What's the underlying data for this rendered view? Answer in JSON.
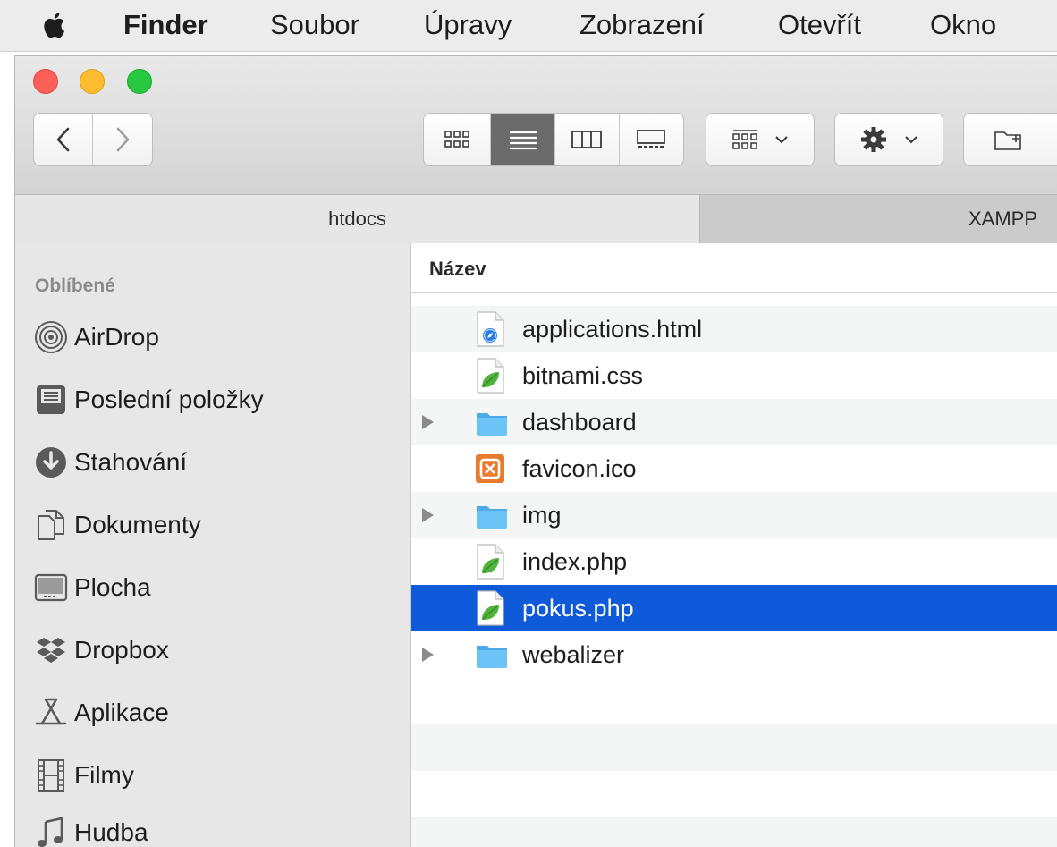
{
  "menubar": {
    "app_name": "Finder",
    "items": [
      "Soubor",
      "Úpravy",
      "Zobrazení",
      "Otevřít",
      "Okno"
    ]
  },
  "tabs": {
    "active": "htdocs",
    "other": "XAMPP"
  },
  "sidebar": {
    "heading": "Oblíbené",
    "items": [
      {
        "label": "AirDrop",
        "icon": "airdrop-icon"
      },
      {
        "label": "Poslední položky",
        "icon": "recents-icon"
      },
      {
        "label": "Stahování",
        "icon": "downloads-icon"
      },
      {
        "label": "Dokumenty",
        "icon": "documents-icon"
      },
      {
        "label": "Plocha",
        "icon": "desktop-icon"
      },
      {
        "label": "Dropbox",
        "icon": "dropbox-icon"
      },
      {
        "label": "Aplikace",
        "icon": "applications-icon"
      },
      {
        "label": "Filmy",
        "icon": "movies-icon"
      },
      {
        "label": "Hudba",
        "icon": "music-icon"
      }
    ]
  },
  "list": {
    "column_name": "Název",
    "files": [
      {
        "name": "applications.html",
        "type": "html",
        "expandable": false,
        "selected": false
      },
      {
        "name": "bitnami.css",
        "type": "leaf",
        "expandable": false,
        "selected": false
      },
      {
        "name": "dashboard",
        "type": "folder",
        "expandable": true,
        "selected": false
      },
      {
        "name": "favicon.ico",
        "type": "xampp",
        "expandable": false,
        "selected": false
      },
      {
        "name": "img",
        "type": "folder",
        "expandable": true,
        "selected": false
      },
      {
        "name": "index.php",
        "type": "leaf",
        "expandable": false,
        "selected": false
      },
      {
        "name": "pokus.php",
        "type": "leaf",
        "expandable": false,
        "selected": true
      },
      {
        "name": "webalizer",
        "type": "folder",
        "expandable": true,
        "selected": false
      }
    ]
  },
  "colors": {
    "selection": "#0e5ad8",
    "close": "#fc5f57",
    "minimize": "#fdbc2e",
    "zoom": "#28c840",
    "folder": "#6bc4f5"
  }
}
